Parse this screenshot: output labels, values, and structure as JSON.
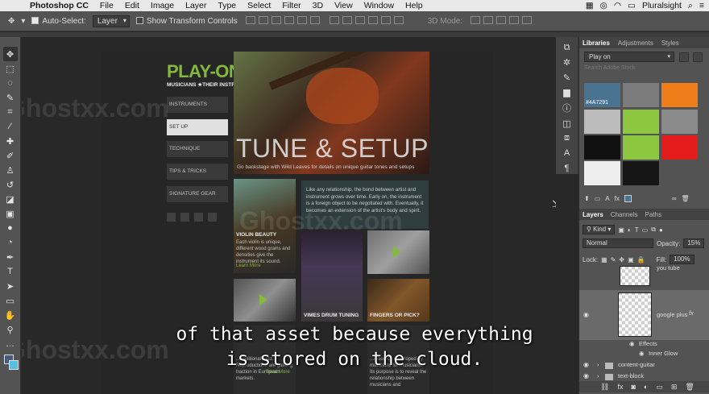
{
  "menubar": {
    "apple_icon": "apple-icon",
    "items": [
      "Photoshop CC",
      "File",
      "Edit",
      "Image",
      "Layer",
      "Type",
      "Select",
      "Filter",
      "3D",
      "View",
      "Window",
      "Help"
    ],
    "user": "Pluralsight"
  },
  "options": {
    "auto_select_label": "Auto-Select:",
    "auto_select_value": "Layer",
    "transform_label": "Show Transform Controls",
    "mode3d_label": "3D Mode:"
  },
  "page": {
    "logo": "PLAY-ON",
    "tagline": "MUSICIANS ★THEIR INSTRUMENTS",
    "nav": [
      "INSTRUMENTS",
      "SET UP",
      "TECHNIQUE",
      "TIPS & TRICKS",
      "SIGNATURE GEAR"
    ],
    "hero_title": "TUNE & SETUP",
    "hero_sub": "Go backstage with Wild Leaves for details on unique guitar tones and setups",
    "intro": "Like any relationship, the bond between artist and instrument grows over time. Early on, the instrument is a foreign object to be negotiated with. Eventually, it becomes an extension of the artist's body and spirit.",
    "violin_title": "VIOLIN BEAUTY",
    "violin_text": "Each violin is unique, different wood grains and densities give the instrument its sound.",
    "learn_more": "Learn More",
    "drum_title": "VIMES DRUM TUNING",
    "fingers_title": "FINGERS OR PICK?",
    "bottom_left": "...traditional Jazz. Reproductions are gaining traction in European markets.",
    "read_more": "Read More",
    "bottom_right": "...resource developed by musicians for musicians. Its purpose is to reveal the relationship between musicians and"
  },
  "subtitle": {
    "line1": "of that asset because everything",
    "line2": "is stored on the cloud."
  },
  "watermark": "Ghostxx.com",
  "libraries": {
    "tabs": [
      "Libraries",
      "Adjustments",
      "Styles"
    ],
    "library_name": "Play on",
    "search_placeholder": "Search Adobe Stock",
    "swatch_label": "#4A7291",
    "swatch_colors": [
      "#4a7291",
      "#7b7b7b",
      "#ef7d1a",
      "#bcbcbc",
      "#8dc63f",
      "#8a8a8a",
      "#111111",
      "#8dc63f",
      "#e31b1b",
      "#eeeeee",
      "#161616"
    ]
  },
  "layers": {
    "tabs": [
      "Layers",
      "Channels",
      "Paths"
    ],
    "filter": "Kind",
    "blend": "Normal",
    "opacity_label": "Opacity:",
    "opacity": "15%",
    "lock_label": "Lock:",
    "fill_label": "Fill:",
    "fill": "100%",
    "rows": {
      "you_tube": "you tube",
      "google_plus": "google plus",
      "effects": "Effects",
      "inner_glow": "Inner Glow",
      "content_guitar": "content-guitar",
      "text_block": "text-block"
    }
  }
}
